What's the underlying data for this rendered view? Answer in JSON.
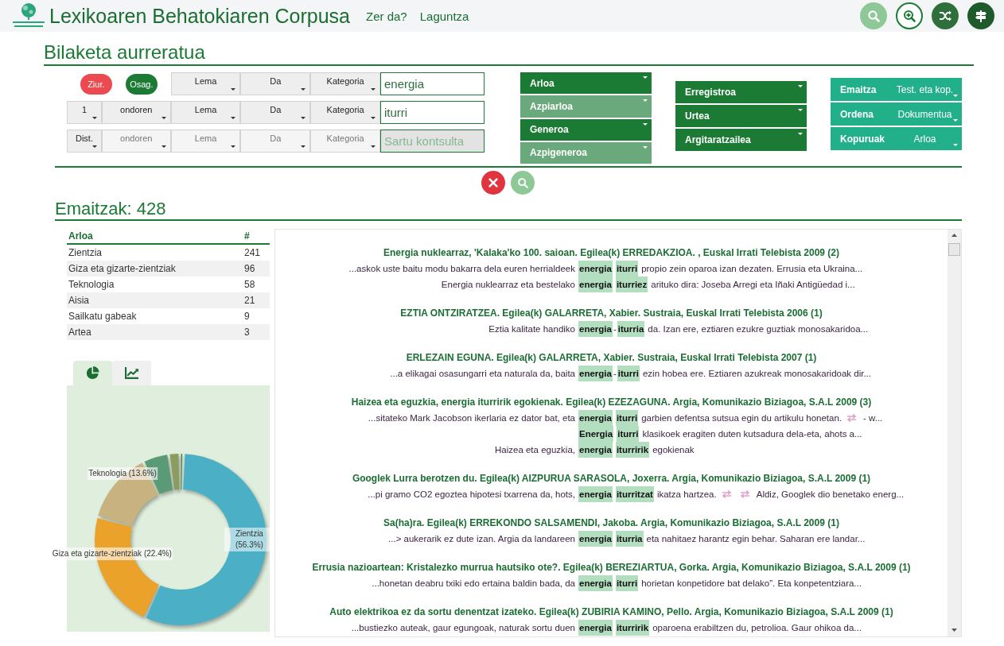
{
  "header": {
    "title": "Lexikoaren Behatokiaren Corpusa",
    "links": [
      {
        "label": "Zer da?"
      },
      {
        "label": "Laguntza"
      }
    ],
    "actions": [
      {
        "kind": "search"
      },
      {
        "kind": "zoom"
      },
      {
        "kind": "shuffle"
      },
      {
        "kind": "signpost"
      }
    ]
  },
  "search": {
    "title": "Bilaketa aurreratua",
    "rows": [
      {
        "toggles": [
          {
            "label": "Ziur.",
            "color": "#ea4a50"
          },
          {
            "label": "Osag.",
            "color": "#1b7a34"
          }
        ],
        "selects": [
          {
            "label": "Lema",
            "disabled": false
          },
          {
            "label": "Da",
            "disabled": false
          },
          {
            "label": "Kategoria",
            "disabled": false
          }
        ],
        "input": {
          "value": "energia",
          "disabled": false
        }
      },
      {
        "selects": [
          {
            "label": "1",
            "disabled": false
          },
          {
            "label": "ondoren",
            "disabled": false
          },
          {
            "label": "Lema",
            "disabled": false
          },
          {
            "label": "Da",
            "disabled": false
          },
          {
            "label": "Kategoria",
            "disabled": false
          }
        ],
        "input": {
          "value": "iturri",
          "disabled": false
        }
      },
      {
        "selects": [
          {
            "label": "Dist.",
            "disabled": false
          },
          {
            "label": "ondoren",
            "disabled": true
          },
          {
            "label": "Lema",
            "disabled": true
          },
          {
            "label": "Da",
            "disabled": true
          },
          {
            "label": "Kategoria",
            "disabled": true
          }
        ],
        "input": {
          "placeholder": "Sartu kontsulta",
          "disabled": true
        }
      }
    ],
    "filters": [
      [
        {
          "label": "Arloa",
          "disabled": false
        },
        {
          "label": "Azpiarloa",
          "disabled": true
        },
        {
          "label": "Generoa",
          "disabled": false
        },
        {
          "label": "Azpigeneroa",
          "disabled": true
        }
      ],
      [
        {
          "label": "Erregistroa",
          "disabled": false
        },
        {
          "label": "Urtea",
          "disabled": false
        },
        {
          "label": "Argitaratzailea",
          "disabled": false
        }
      ]
    ],
    "options": [
      {
        "label": "Emaitza",
        "value": "Test. eta kop."
      },
      {
        "label": "Ordena",
        "value": "Dokumentua"
      },
      {
        "label": "Kopuruak",
        "value": "Arloa"
      }
    ],
    "actions": [
      {
        "kind": "clear"
      },
      {
        "kind": "search"
      }
    ]
  },
  "results": {
    "title": "Emaitzak: 428",
    "table": {
      "columns": [
        "Arloa",
        "#"
      ],
      "rows": [
        [
          "Zientzia",
          "241"
        ],
        [
          "Giza eta gizarte-zientziak",
          "96"
        ],
        [
          "Teknologia",
          "58"
        ],
        [
          "Aisia",
          "21"
        ],
        [
          "Sailkatu gabeak",
          "9"
        ],
        [
          "Artea",
          "3"
        ]
      ]
    },
    "chart_tabs": [
      {
        "kind": "pie",
        "selected": true
      },
      {
        "kind": "line",
        "selected": false
      }
    ],
    "chart_data": {
      "type": "donut",
      "values": [
        56.3,
        22.4,
        13.6,
        4.9,
        2.1,
        0.7
      ],
      "value_labels": [
        "Zientzia (56.3%)",
        "Giza eta gizarte-zientziak (22.4%)",
        "Teknologia (13.6%)",
        null,
        null,
        null
      ]
    },
    "documents": [
      {
        "title": "Energia nuklearraz, 'Kalaka'ko 100. saioan. Egilea(k) ERREDAKZIOA. , Euskal Irrati Telebista 2009 (2)",
        "lines": [
          {
            "left": "...askok uste baitu modu bakarra dela euren herrialdeek",
            "keywords": [
              "energia",
              "iturri"
            ],
            "right": [
              {
                "kind": "text",
                "text": "propio zein oparoa izan dezaten. Errusia eta Ukraina..."
              }
            ]
          },
          {
            "left": "Energia nuklearraz eta bestelako",
            "keywords": [
              "energia",
              "iturriez"
            ],
            "right": [
              {
                "kind": "text",
                "text": "arituko dira: Joseba Arregi eta Iñaki Antigüedad i..."
              }
            ]
          }
        ]
      },
      {
        "title": "EZTIA ONTZIRATZEA. Egilea(k) GALARRETA, Xabier. Sustraia, Euskal Irrati Telebista 2006 (1)",
        "lines": [
          {
            "left": "Eztia kalitate handiko",
            "keywords": [
              "energia",
              "iturria"
            ],
            "sep": "-",
            "right": [
              {
                "kind": "text",
                "text": "da. Izan ere, eztiaren ezukre guztiak monosakaridoa..."
              }
            ]
          }
        ]
      },
      {
        "title": "ERLEZAIN EGUNA. Egilea(k) GALARRETA, Xabier. Sustraia, Euskal Irrati Telebista 2007 (1)",
        "lines": [
          {
            "left": "...a elikagai osasungarri eta naturala da, baita",
            "keywords": [
              "energia",
              "iturri"
            ],
            "sep": "-",
            "right": [
              {
                "kind": "text",
                "text": "ezin hobea ere. Eztiaren azukreak monosakaridoak dir..."
              }
            ]
          }
        ]
      },
      {
        "title": "Haizea eta eguzkia, energia iturririk egokienak. Egilea(k) EZEZAGUNA. Argia, Komunikazio Biziagoa, S.A.L 2009 (3)",
        "lines": [
          {
            "left": "...sitateko Mark Jacobson ikerlaria ez dator bat, eta",
            "keywords": [
              "energia",
              "iturri"
            ],
            "right": [
              {
                "kind": "text",
                "text": "garbien defentsa sutsua egin du artikulu honetan."
              },
              {
                "kind": "swap"
              },
              {
                "kind": "text",
                "text": "- w..."
              }
            ]
          },
          {
            "keywords": [
              "Energia",
              "iturri"
            ],
            "right": [
              {
                "kind": "text",
                "text": "klasikoek eragiten duten kutsadura dela-eta, ahots a..."
              }
            ]
          },
          {
            "left": "Haizea eta eguzkia,",
            "keywords": [
              "energia",
              "iturririk"
            ],
            "right": [
              {
                "kind": "text",
                "text": "egokienak"
              }
            ]
          }
        ]
      },
      {
        "title": "Googlek Lurra berotzen du. Egilea(k) AIZPURUA SARASOLA, Joxerra. Argia, Komunikazio Biziagoa, S.A.L 2009 (1)",
        "lines": [
          {
            "left": "...pi gramo CO2 egoztea hipotesi txarrena da, hots,",
            "keywords": [
              "energia",
              "iturritzat"
            ],
            "right": [
              {
                "kind": "text",
                "text": "ikatza hartzea."
              },
              {
                "kind": "swap"
              },
              {
                "kind": "swap"
              },
              {
                "kind": "text",
                "text": "Aldiz, Googlek dio benetako energ..."
              }
            ]
          }
        ]
      },
      {
        "title": "Sa(ha)ra. Egilea(k) ERREKONDO SALSAMENDI, Jakoba. Argia, Komunikazio Biziagoa, S.A.L 2009 (1)",
        "lines": [
          {
            "left": "...> aukerarik ez dute izan. Argia da landareen",
            "keywords": [
              "energia",
              "iturria"
            ],
            "right": [
              {
                "kind": "text",
                "text": "eta nahitaez harantz egin behar. Saharan ere landar..."
              }
            ]
          }
        ]
      },
      {
        "title": "Errusia nazioartean: Kristalezko murrua hautsiko ote?. Egilea(k) BEREZIARTUA, Gorka. Argia, Komunikazio Biziagoa, S.A.L 2009 (1)",
        "lines": [
          {
            "left": "...honetan deabru txiki edo ertaina baldin bada, da",
            "keywords": [
              "energia",
              "iturri"
            ],
            "right": [
              {
                "kind": "text",
                "text": "horietan konpetidore bat delako”. Eta konpetentziara..."
              }
            ]
          }
        ]
      },
      {
        "title": "Auto elektrikoa ez da sortu denentzat izateko. Egilea(k) ZUBIRIA KAMINO, Pello. Argia, Komunikazio Biziagoa, S.A.L 2009 (1)",
        "lines": [
          {
            "left": "...bustiezko auteak, gaur egungoak, naturak sortu duen",
            "keywords": [
              "energia",
              "iturririk"
            ],
            "right": [
              {
                "kind": "text",
                "text": "oparoena erabiltzen du, petrolioa. Gaur ohikoa da..."
              }
            ]
          }
        ]
      }
    ]
  }
}
